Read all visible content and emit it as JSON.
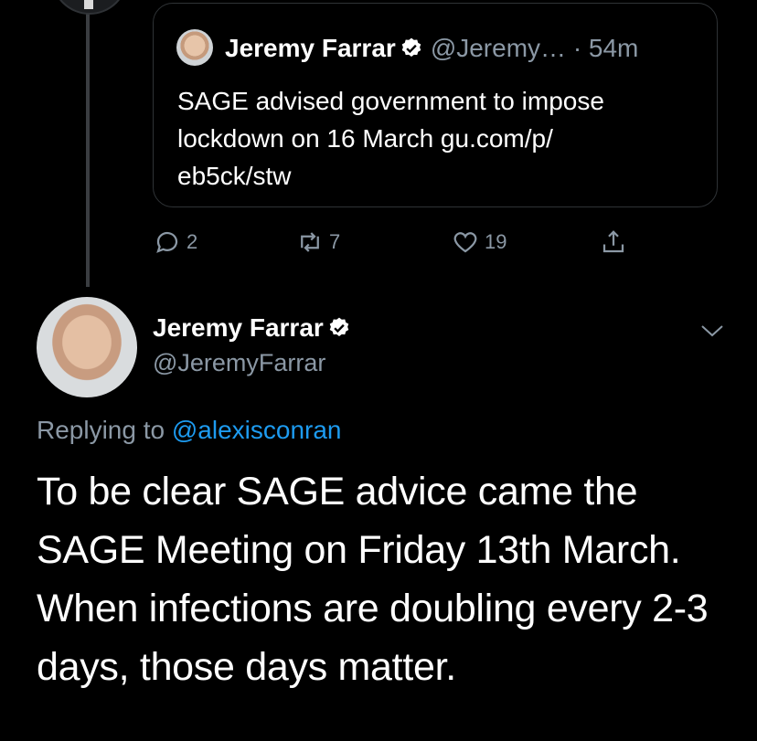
{
  "quoted_tweet": {
    "name": "Jeremy Farrar",
    "handle": "@Jeremy…",
    "time": "· 54m",
    "text": "SAGE advised government to impose lockdown on 16 March  gu.com/p/\neb5ck/stw"
  },
  "actions": {
    "reply_count": "2",
    "retweet_count": "7",
    "like_count": "19"
  },
  "main_tweet": {
    "name": "Jeremy Farrar",
    "handle": "@JeremyFarrar",
    "replying_prefix": "Replying to ",
    "replying_to": "@alexisconran",
    "text": "To be clear SAGE advice came the SAGE Meeting on Friday 13th March. When infections are doubling every 2-3 days, those days matter."
  },
  "icons": [
    "verified-icon",
    "reply-icon",
    "retweet-icon",
    "like-icon",
    "share-icon",
    "chevron-down-icon"
  ],
  "colors": {
    "background": "#000000",
    "muted": "#8b98a5",
    "link": "#1d9bf0",
    "border": "#2f3336"
  }
}
